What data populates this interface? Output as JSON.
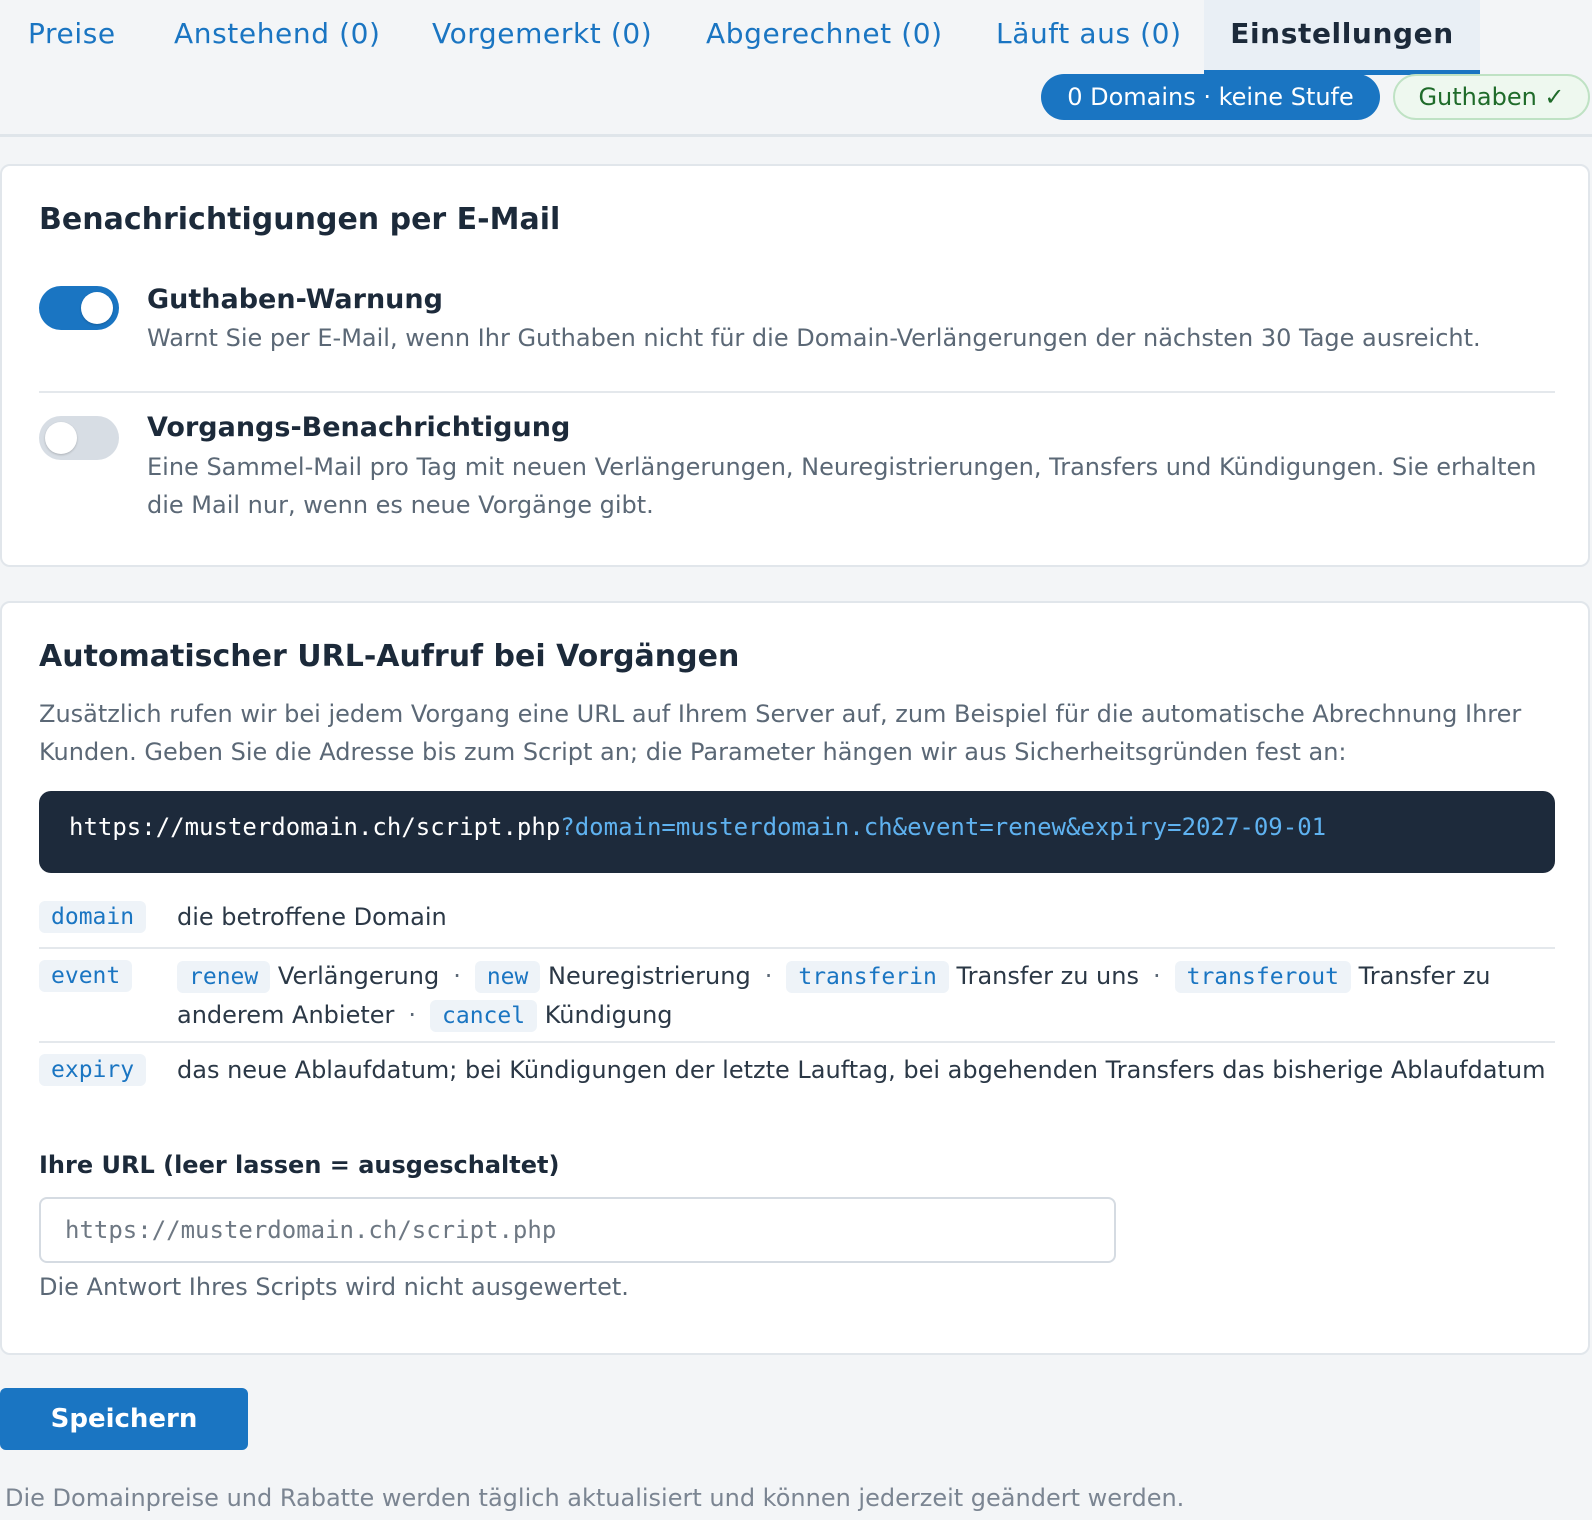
{
  "tabs": [
    {
      "label": "Preise"
    },
    {
      "label": "Anstehend (0)"
    },
    {
      "label": "Vorgemerkt (0)"
    },
    {
      "label": "Abgerechnet (0)"
    },
    {
      "label": "Läuft aus (0)"
    },
    {
      "label": "Einstellungen",
      "active": true
    }
  ],
  "status": {
    "domains_pill": "0 Domains · keine Stufe",
    "credit_pill": "Guthaben ✓"
  },
  "email": {
    "heading": "Benachrichtigungen per E-Mail",
    "options": [
      {
        "title": "Guthaben-Warnung",
        "description": "Warnt Sie per E-Mail, wenn Ihr Guthaben nicht für die Domain-Verlängerungen der nächsten 30 Tage ausreicht.",
        "enabled": true
      },
      {
        "title": "Vorgangs-Benachrichtigung",
        "description": "Eine Sammel-Mail pro Tag mit neuen Verlängerungen, Neuregistrierungen, Transfers und Kündigungen. Sie erhalten die Mail nur, wenn es neue Vorgänge gibt.",
        "enabled": false
      }
    ]
  },
  "webhook": {
    "heading": "Automatischer URL-Aufruf bei Vorgängen",
    "intro": "Zusätzlich rufen wir bei jedem Vorgang eine URL auf Ihrem Server auf, zum Beispiel für die automatische Abrechnung Ihrer Kunden. Geben Sie die Adresse bis zum Script an; die Parameter hängen wir aus Sicherheitsgründen fest an:",
    "example_base": "https://musterdomain.ch/script.php",
    "example_params": "?domain=musterdomain.ch&event=renew&expiry=2027-09-01",
    "params": {
      "domain": {
        "code": "domain",
        "desc": "die betroffene Domain"
      },
      "event": {
        "code": "event",
        "values": [
          {
            "code": "renew",
            "label": "Verlängerung"
          },
          {
            "code": "new",
            "label": "Neuregistrierung"
          },
          {
            "code": "transferin",
            "label": "Transfer zu uns"
          },
          {
            "code": "transferout",
            "label": "Transfer zu anderem Anbieter"
          },
          {
            "code": "cancel",
            "label": "Kündigung"
          }
        ]
      },
      "expiry": {
        "code": "expiry",
        "desc": "das neue Ablaufdatum; bei Kündigungen der letzte Lauftag, bei abgehenden Transfers das bisherige Ablaufdatum"
      }
    },
    "url_label": "Ihre URL (leer lassen = ausgeschaltet)",
    "url_value": "",
    "url_placeholder": "https://musterdomain.ch/script.php",
    "url_hint": "Die Antwort Ihres Scripts wird nicht ausgewertet."
  },
  "save_label": "Speichern",
  "footer_note": "Die Domainpreise und Rabatte werden täglich aktualisiert und können jederzeit geändert werden.",
  "colors": {
    "accent": "#1a75c2",
    "code_bg": "#1d2a3b",
    "success": "#1f6b2a"
  }
}
